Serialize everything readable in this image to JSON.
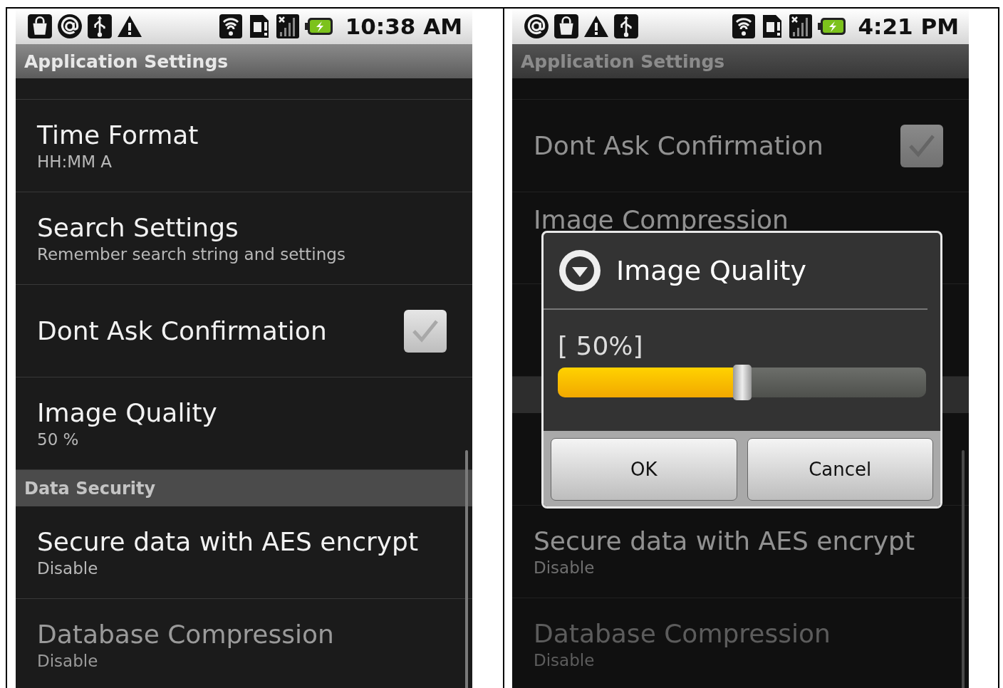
{
  "screens": [
    {
      "status_bar": {
        "notifications": [
          {
            "kind": "bag"
          },
          {
            "kind": "at"
          },
          {
            "kind": "usb"
          },
          {
            "kind": "warning"
          }
        ],
        "time": "10:38 AM"
      },
      "title": "Application Settings",
      "dimmed": false,
      "items": [
        {
          "kind": "sliver"
        },
        {
          "kind": "preference",
          "title": "Time Format",
          "summary": "HH:MM A",
          "disabled": false
        },
        {
          "kind": "preference",
          "title": "Search Settings",
          "summary": "Remember search string and settings",
          "disabled": false
        },
        {
          "kind": "checkbox",
          "title": "Dont Ask Confirmation",
          "checked": true,
          "disabled": false
        },
        {
          "kind": "preference",
          "title": "Image Quality",
          "summary": "50 %",
          "disabled": false
        },
        {
          "kind": "category",
          "title": "Data Security"
        },
        {
          "kind": "preference",
          "title": "Secure data with AES encrypt",
          "summary": "Disable",
          "disabled": false
        },
        {
          "kind": "preference",
          "title": "Database Compression",
          "summary": "Disable",
          "disabled": true
        }
      ]
    },
    {
      "status_bar": {
        "notifications": [
          {
            "kind": "at"
          },
          {
            "kind": "bag"
          },
          {
            "kind": "warning"
          },
          {
            "kind": "usb"
          }
        ],
        "time": "4:21 PM"
      },
      "title": "Application Settings",
      "dimmed": true,
      "items": [
        {
          "kind": "sliver"
        },
        {
          "kind": "checkbox",
          "title": "Dont Ask Confirmation",
          "checked": true,
          "disabled": false
        },
        {
          "kind": "preference",
          "title": "Image Compression",
          "disabled": false
        },
        {
          "kind": "preference"
        },
        {
          "kind": "category"
        },
        {
          "kind": "preference"
        },
        {
          "kind": "preference",
          "title": "Secure data with AES encrypt",
          "summary": "Disable",
          "disabled": false
        },
        {
          "kind": "preference",
          "title": "Database Compression",
          "summary": "Disable",
          "disabled": true
        }
      ],
      "dialog": {
        "title": "Image Quality",
        "reading": "[ 50%]",
        "level": 0.5,
        "buttons": [
          {
            "label": "OK"
          },
          {
            "label": "Cancel"
          }
        ]
      }
    }
  ]
}
